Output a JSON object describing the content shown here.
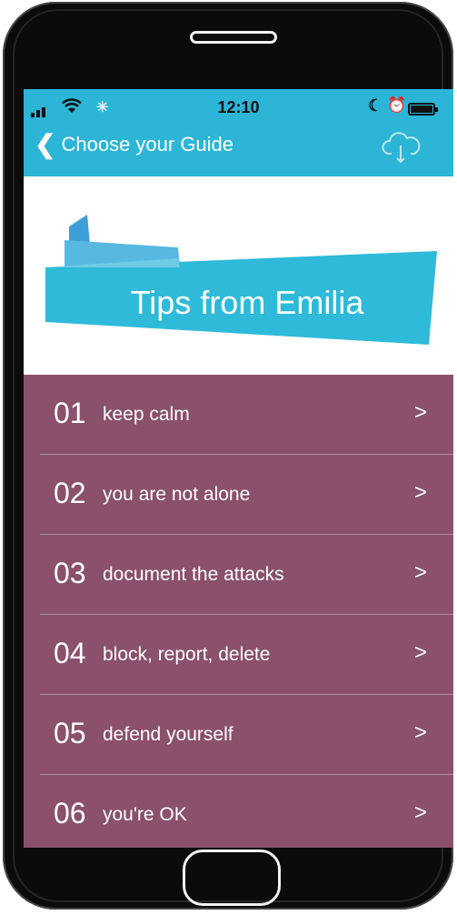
{
  "status_bar": {
    "time": "12:10",
    "icons": [
      "signal-icon",
      "wifi-icon",
      "spinner-icon",
      "moon-icon",
      "alarm-icon",
      "battery-icon"
    ]
  },
  "nav": {
    "back_label": "Choose your Guide",
    "cloud_icon": "cloud-download-icon"
  },
  "banner": {
    "title": "Tips from Emilia"
  },
  "tips": [
    {
      "number": "01",
      "label": "keep calm"
    },
    {
      "number": "02",
      "label": "you are not alone"
    },
    {
      "number": "03",
      "label": "document the attacks"
    },
    {
      "number": "04",
      "label": "block, report, delete"
    },
    {
      "number": "05",
      "label": "defend yourself"
    },
    {
      "number": "06",
      "label": "you're OK"
    }
  ],
  "colors": {
    "accent": "#2cb5d6",
    "list_background": "#8a506c",
    "banner_dark": "#3a9fd6"
  }
}
